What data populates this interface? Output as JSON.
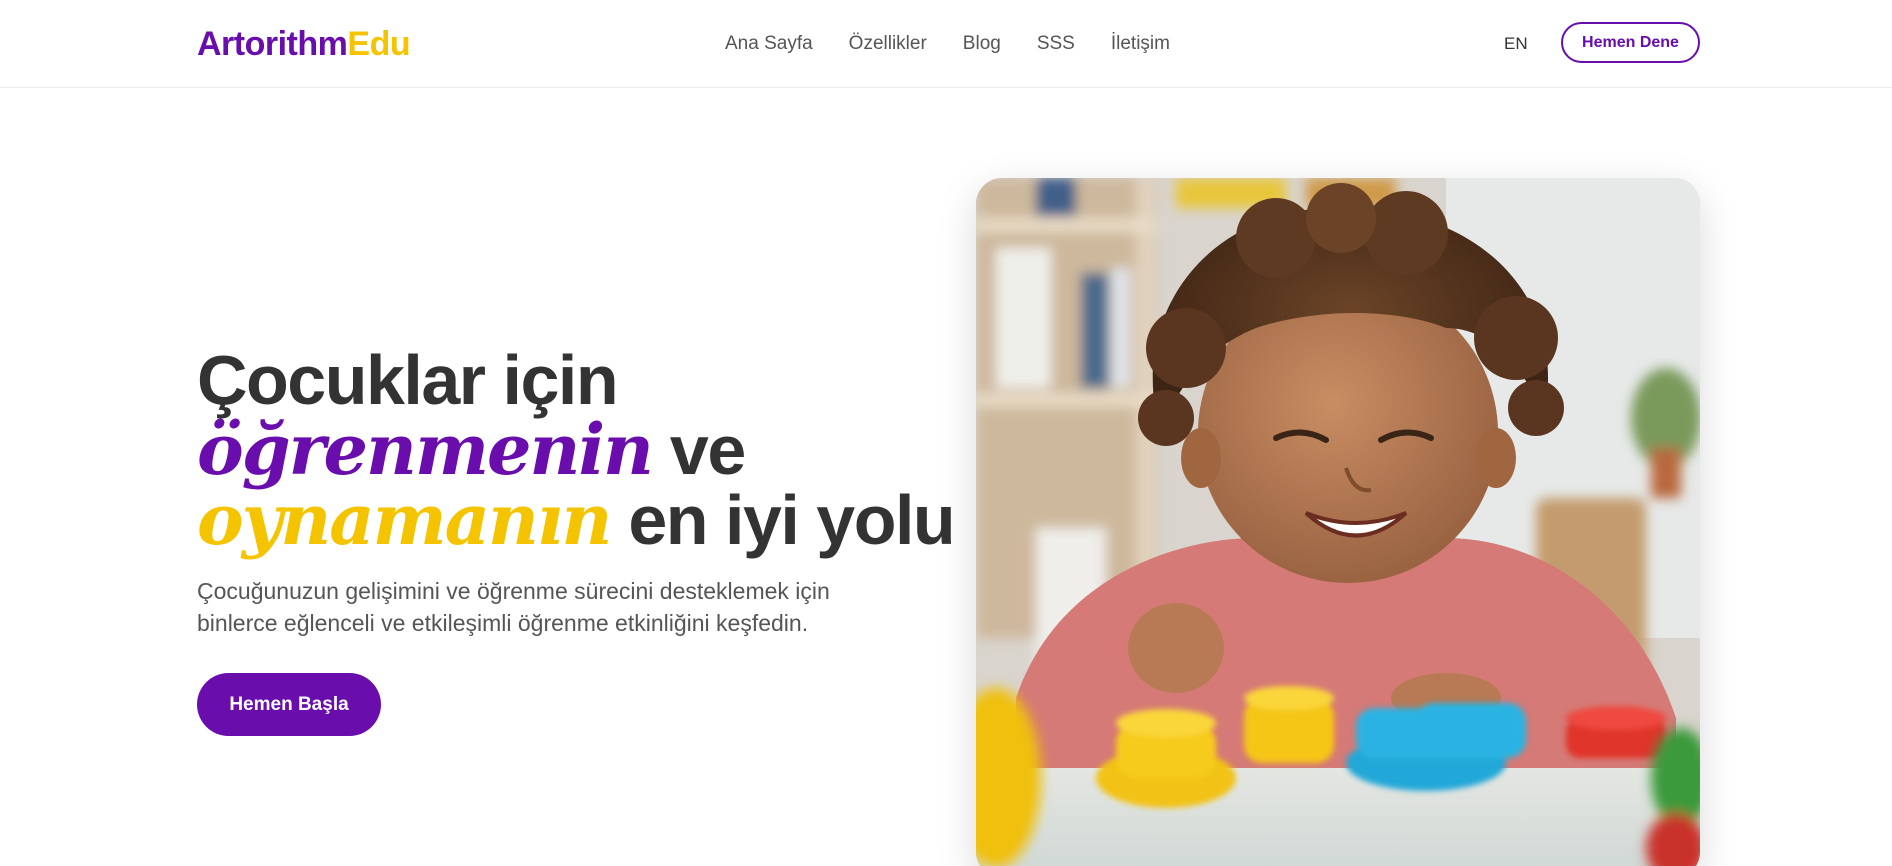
{
  "header": {
    "logo_part1": "Artorithm",
    "logo_part2": "Edu",
    "nav": [
      "Ana Sayfa",
      "Özellikler",
      "Blog",
      "SSS",
      "İletişim"
    ],
    "lang": "EN",
    "cta": "Hemen Dene"
  },
  "hero": {
    "line1": "Çocuklar için",
    "line2_highlight": "öğrenmenin",
    "line2_rest": " ve",
    "line3_highlight": "oynamanın",
    "line3_rest": " en iyi yolu",
    "subtitle_line1": "Çocuğunuzun gelişimini ve öğrenme sürecini desteklemek için",
    "subtitle_line2": "binlerce eğlenceli ve etkileşimli öğrenme etkinliğini keşfedin.",
    "cta": "Hemen Başla"
  },
  "colors": {
    "brand_purple": "#6a0dad",
    "brand_yellow": "#f5c400"
  }
}
